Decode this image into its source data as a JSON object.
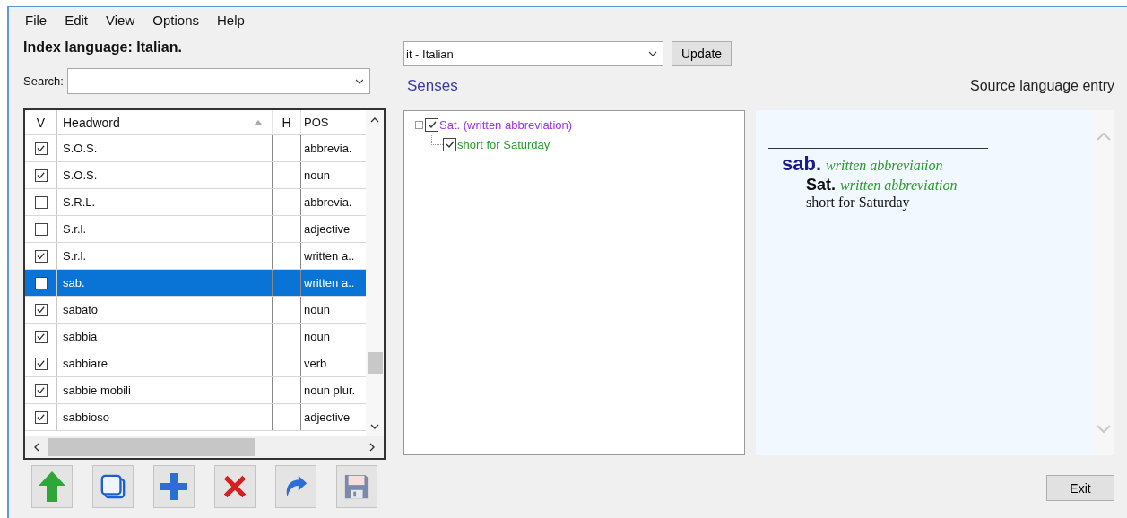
{
  "menu": [
    "File",
    "Edit",
    "View",
    "Options",
    "Help"
  ],
  "index_language": "Index language: Italian.",
  "search": {
    "label": "Search:"
  },
  "table": {
    "columns": [
      {
        "label": "V"
      },
      {
        "label": "Headword",
        "sorted": true
      },
      {
        "label": "H"
      },
      {
        "label": "POS"
      }
    ],
    "rows": [
      {
        "checked": true,
        "headword": "S.O.S.",
        "pos": "abbrevia.",
        "selected": false
      },
      {
        "checked": true,
        "headword": "S.O.S.",
        "pos": "noun",
        "selected": false
      },
      {
        "checked": false,
        "headword": "S.R.L.",
        "pos": "abbrevia.",
        "selected": false
      },
      {
        "checked": false,
        "headword": "S.r.l.",
        "pos": "adjective",
        "selected": false
      },
      {
        "checked": true,
        "headword": "S.r.l.",
        "pos": "written a..",
        "selected": false
      },
      {
        "checked": false,
        "headword": "sab.",
        "pos": "written a..",
        "selected": true
      },
      {
        "checked": true,
        "headword": "sabato",
        "pos": "noun",
        "selected": false
      },
      {
        "checked": true,
        "headword": "sabbia",
        "pos": "noun",
        "selected": false
      },
      {
        "checked": true,
        "headword": "sabbiare",
        "pos": "verb",
        "selected": false
      },
      {
        "checked": true,
        "headword": "sabbie mobili",
        "pos": "noun plur.",
        "selected": false
      },
      {
        "checked": true,
        "headword": "sabbioso",
        "pos": "adjective",
        "selected": false
      }
    ]
  },
  "toolbar": [
    {
      "kind": "up"
    },
    {
      "kind": "copy"
    },
    {
      "kind": "add"
    },
    {
      "kind": "delete"
    },
    {
      "kind": "redo"
    },
    {
      "kind": "save"
    }
  ],
  "language_select": {
    "value": "it - Italian"
  },
  "update_button": "Update",
  "senses_label": "Senses",
  "senses_tree": [
    {
      "label": "Sat. (written abbreviation)",
      "kind": "sense",
      "checked": true,
      "expanded": true,
      "children": [
        {
          "label": "short for Saturday",
          "kind": "definition",
          "checked": true
        }
      ]
    }
  ],
  "source_label": "Source language entry",
  "entry": {
    "headword": "sab.",
    "grammar": "written abbreviation",
    "senses": [
      {
        "term": "Sat.",
        "grammar": "written abbreviation",
        "definition": "short for Saturday"
      }
    ]
  },
  "exit_button": "Exit"
}
